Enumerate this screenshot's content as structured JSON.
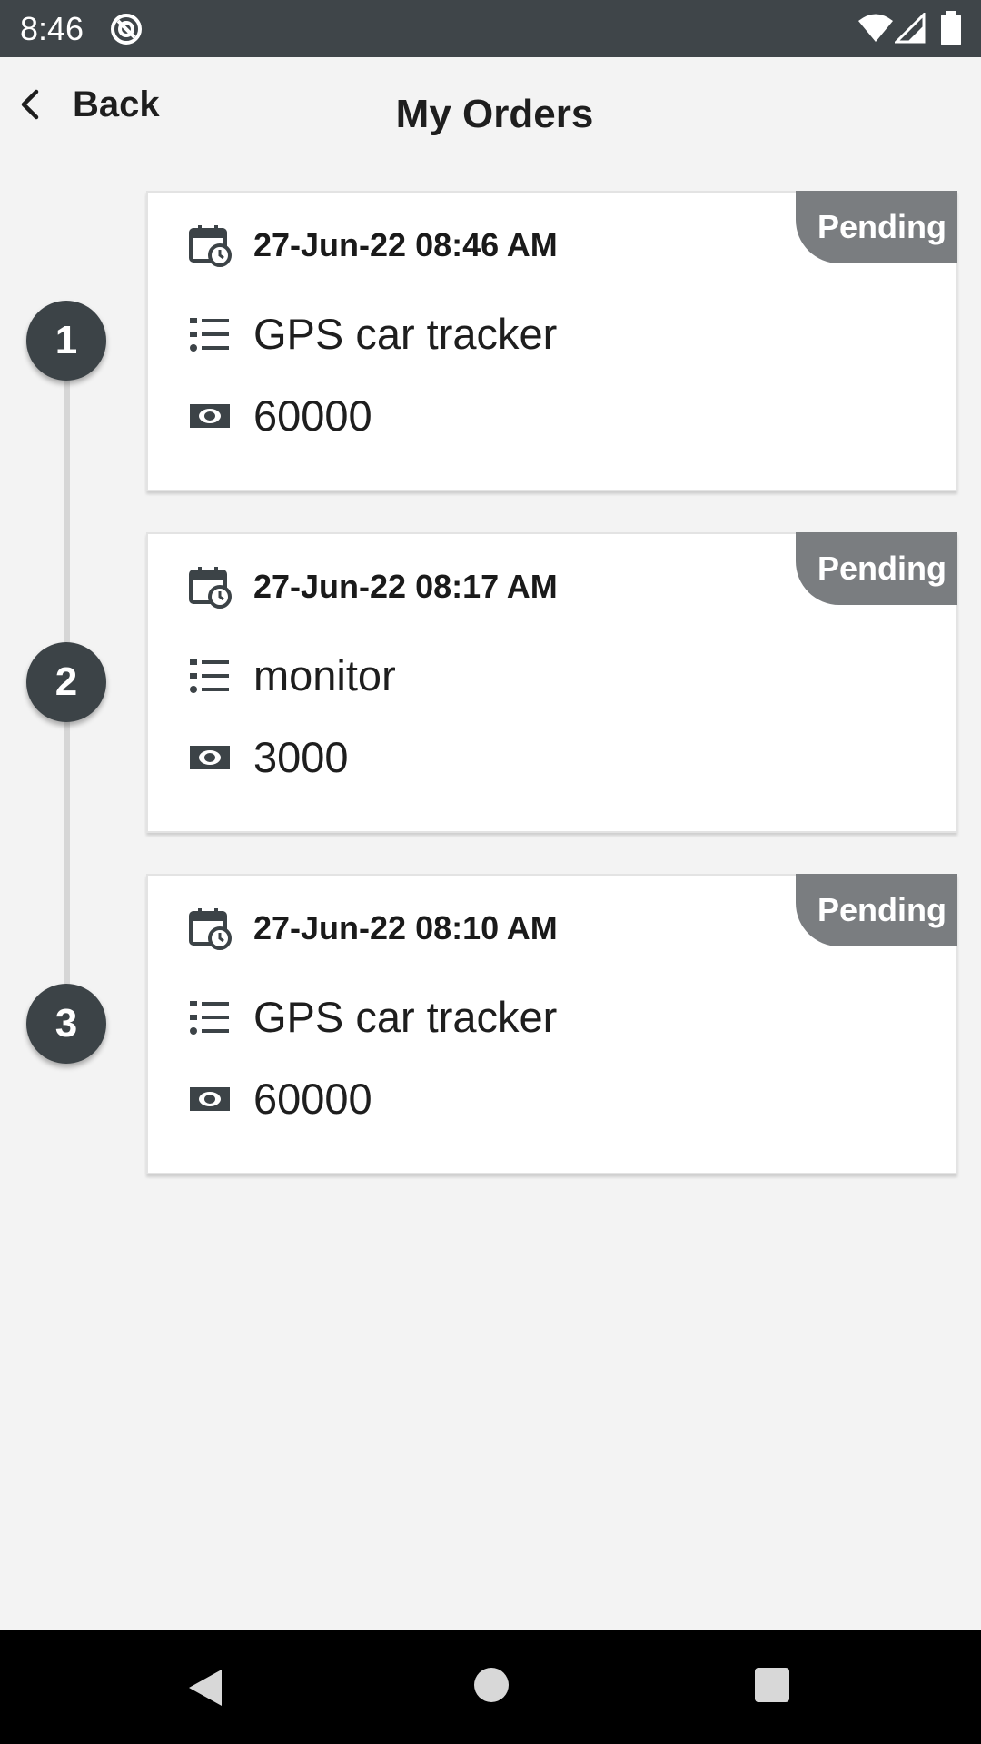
{
  "status_bar": {
    "time": "8:46",
    "icons": [
      "notification-icon",
      "wifi-icon",
      "signal-icon",
      "battery-icon"
    ]
  },
  "header": {
    "back_label": "Back",
    "title": "My Orders"
  },
  "orders": [
    {
      "number": "1",
      "status": "Pending",
      "datetime": "27-Jun-22 08:46 AM",
      "item": "GPS car tracker",
      "price": "60000"
    },
    {
      "number": "2",
      "status": "Pending",
      "datetime": "27-Jun-22 08:17 AM",
      "item": "monitor",
      "price": "3000"
    },
    {
      "number": "3",
      "status": "Pending",
      "datetime": "27-Jun-22 08:10 AM",
      "item": "GPS car tracker",
      "price": "60000"
    }
  ],
  "colors": {
    "status_bar_bg": "#3f4549",
    "page_bg": "#f3f3f3",
    "badge_bg": "#7a7d80",
    "number_circle_bg": "#3c4347",
    "nav_bar_bg": "#000000"
  }
}
